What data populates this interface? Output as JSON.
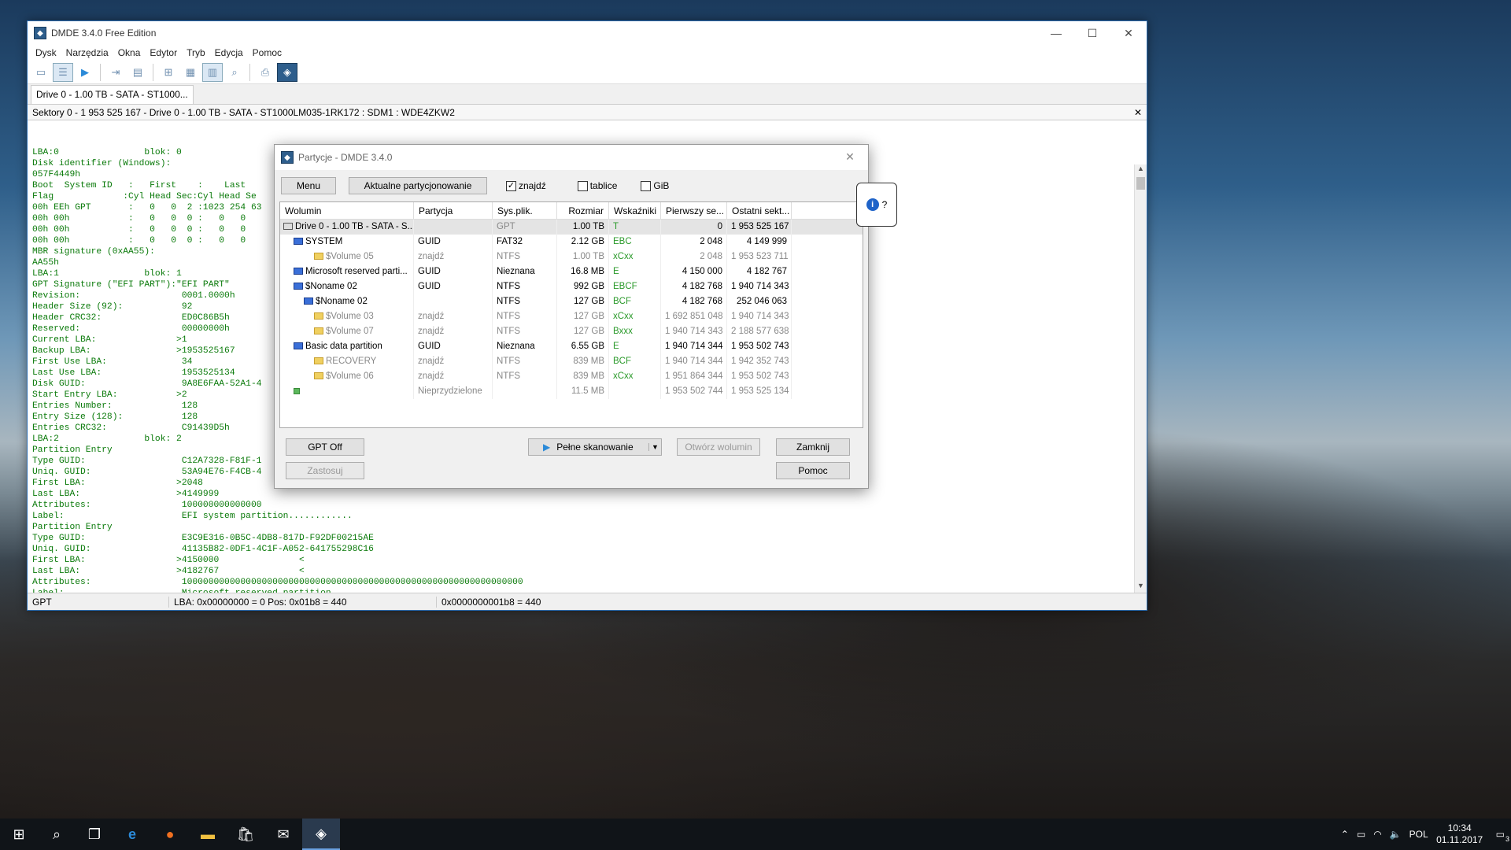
{
  "main_window": {
    "title": "DMDE 3.4.0 Free Edition",
    "menu": [
      "Dysk",
      "Narzędzia",
      "Okna",
      "Edytor",
      "Tryb",
      "Edycja",
      "Pomoc"
    ],
    "tab": "Drive 0 - 1.00 TB - SATA - ST1000...",
    "path": "Sektory 0 - 1 953 525 167 - Drive 0 - 1.00 TB - SATA - ST1000LM035-1RK172 : SDM1 : WDE4ZKW2",
    "hex_lines": [
      "LBA:0                blok: 0",
      "Disk identifier (Windows):",
      "057F4449h",
      "Boot  System ID   :   First    :    Last",
      "Flag             :Cyl Head Sec:Cyl Head Se",
      "00h EEh GPT       :   0   0  2 :1023 254 63",
      "00h 00h           :   0   0  0 :   0   0",
      "00h 00h           :   0   0  0 :   0   0",
      "00h 00h           :   0   0  0 :   0   0",
      "MBR signature (0xAA55):",
      "AA55h",
      "LBA:1                blok: 1",
      "GPT Signature (\"EFI PART\"):\"EFI PART\"",
      "Revision:                   0001.0000h",
      "Header Size (92):           92",
      "Header CRC32:               ED0C86B5h",
      "Reserved:                   00000000h",
      "Current LBA:               >1",
      "Backup LBA:                >1953525167",
      "First Use LBA:              34",
      "Last Use LBA:               1953525134",
      "Disk GUID:                  9A8E6FAA-52A1-4",
      "Start Entry LBA:           >2",
      "Entries Number:             128",
      "Entry Size (128):           128",
      "Entries CRC32:              C91439D5h",
      "LBA:2                blok: 2",
      "Partition Entry",
      "Type GUID:                  C12A7328-F81F-1",
      "Uniq. GUID:                 53A94E76-F4CB-4",
      "First LBA:                 >2048",
      "Last LBA:                  >4149999",
      "Attributes:                 100000000000000",
      "Label:                      EFI system partition............",
      "Partition Entry",
      "Type GUID:                  E3C9E316-0B5C-4DB8-817D-F92DF00215AE",
      "Uniq. GUID:                 41135B82-0DF1-4C1F-A052-641755298C16",
      "First LBA:                 >4150000               <",
      "Last LBA:                  >4182767               <",
      "Attributes:                 1000000000000000000000000000000000000000000000000000000000000000",
      "Label:                      Microsoft reserved partition"
    ],
    "status": {
      "mode": "GPT",
      "lba": "LBA: 0x00000000 = 0  Pos: 0x01b8 = 440",
      "offset": "0x0000000001b8 = 440"
    }
  },
  "dialog": {
    "title": "Partycje - DMDE 3.4.0",
    "menu_btn": "Menu",
    "current_btn": "Aktualne partycjonowanie",
    "chk_znajdz": "znajdź",
    "chk_tablice": "tablice",
    "chk_gib": "GiB",
    "columns": [
      "Wolumin",
      "Partycja",
      "Sys.plik.",
      "Rozmiar",
      "Wskaźniki",
      "Pierwszy se...",
      "Ostatni sekt..."
    ],
    "rows": [
      {
        "name": "Drive 0 - 1.00 TB - SATA - S...",
        "part": "",
        "fs": "GPT",
        "size": "1.00 TB",
        "flags": "T",
        "first": "0",
        "last": "1 953 525 167",
        "indent": 0,
        "icon": "drive",
        "dim": false
      },
      {
        "name": "SYSTEM",
        "part": "GUID",
        "fs": "FAT32",
        "size": "2.12 GB",
        "flags": "EBC",
        "first": "2 048",
        "last": "4 149 999",
        "indent": 1,
        "icon": "blue",
        "dim": false
      },
      {
        "name": "$Volume 05",
        "part": "znajdź",
        "fs": "NTFS",
        "size": "1.00 TB",
        "flags": "xCxx",
        "first": "2 048",
        "last": "1 953 523 711",
        "indent": 3,
        "icon": "yel",
        "dim": true
      },
      {
        "name": "Microsoft reserved parti...",
        "part": "GUID",
        "fs": "Nieznana",
        "size": "16.8 MB",
        "flags": "E",
        "first": "4 150 000",
        "last": "4 182 767",
        "indent": 1,
        "icon": "blue",
        "dim": false
      },
      {
        "name": "$Noname 02",
        "part": "GUID",
        "fs": "NTFS",
        "size": "992 GB",
        "flags": "EBCF",
        "first": "4 182 768",
        "last": "1 940 714 343",
        "indent": 1,
        "icon": "blue",
        "dim": false
      },
      {
        "name": "$Noname 02",
        "part": "",
        "fs": "NTFS",
        "size": "127 GB",
        "flags": "BCF",
        "first": "4 182 768",
        "last": "252 046 063",
        "indent": 2,
        "icon": "blue",
        "dim": false
      },
      {
        "name": "$Volume 03",
        "part": "znajdź",
        "fs": "NTFS",
        "size": "127 GB",
        "flags": "xCxx",
        "first": "1 692 851 048",
        "last": "1 940 714 343",
        "indent": 3,
        "icon": "yel",
        "dim": true
      },
      {
        "name": "$Volume 07",
        "part": "znajdź",
        "fs": "NTFS",
        "size": "127 GB",
        "flags": "Bxxx",
        "first": "1 940 714 343",
        "last": "2 188 577 638",
        "indent": 3,
        "icon": "yel",
        "dim": true
      },
      {
        "name": "Basic data partition",
        "part": "GUID",
        "fs": "Nieznana",
        "size": "6.55 GB",
        "flags": "E",
        "first": "1 940 714 344",
        "last": "1 953 502 743",
        "indent": 1,
        "icon": "blue",
        "dim": false
      },
      {
        "name": "RECOVERY",
        "part": "znajdź",
        "fs": "NTFS",
        "size": "839 MB",
        "flags": "BCF",
        "first": "1 940 714 344",
        "last": "1 942 352 743",
        "indent": 3,
        "icon": "yel",
        "dim": true
      },
      {
        "name": "$Volume 06",
        "part": "znajdź",
        "fs": "NTFS",
        "size": "839 MB",
        "flags": "xCxx",
        "first": "1 951 864 344",
        "last": "1 953 502 743",
        "indent": 3,
        "icon": "yel",
        "dim": true
      },
      {
        "name": "",
        "part": "Nieprzydzielone",
        "fs": "",
        "size": "11.5 MB",
        "flags": "",
        "first": "1 953 502 744",
        "last": "1 953 525 134",
        "indent": 1,
        "icon": "grn",
        "dim": true
      }
    ],
    "btn_gpt": "GPT Off",
    "btn_apply": "Zastosuj",
    "btn_scan": "Pełne skanowanie",
    "btn_open": "Otwórz wolumin",
    "btn_close": "Zamknij",
    "btn_help": "Pomoc"
  },
  "tooltip": {
    "text": "?"
  },
  "taskbar": {
    "lang": "POL",
    "time": "10:34",
    "date": "01.11.2017",
    "notif": "3"
  }
}
